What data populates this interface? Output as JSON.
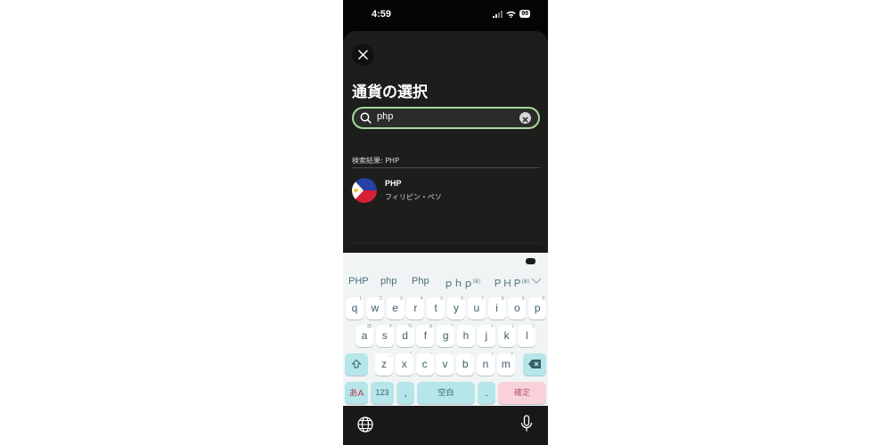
{
  "status_bar": {
    "time": "4:59",
    "battery": "99"
  },
  "sheet": {
    "title": "通貨の選択",
    "search": {
      "value": "php"
    },
    "results_label": "検索結果: PHP",
    "results": [
      {
        "code": "PHP",
        "name": "フィリピン・ペソ",
        "flag": "philippines-flag"
      }
    ]
  },
  "keyboard": {
    "candidates": [
      "PHP",
      "php",
      "Php",
      "ｐｈｐ",
      "ＰＨＰ"
    ],
    "candidate_marks": [
      "[全]",
      "[全]"
    ],
    "row1": [
      {
        "k": "q",
        "h": "1"
      },
      {
        "k": "w",
        "h": "2"
      },
      {
        "k": "e",
        "h": "3"
      },
      {
        "k": "r",
        "h": "4"
      },
      {
        "k": "t",
        "h": "5"
      },
      {
        "k": "y",
        "h": "6"
      },
      {
        "k": "u",
        "h": "7"
      },
      {
        "k": "i",
        "h": "8"
      },
      {
        "k": "o",
        "h": "9"
      },
      {
        "k": "p",
        "h": "0"
      }
    ],
    "row2": [
      {
        "k": "a",
        "h": "@"
      },
      {
        "k": "s",
        "h": "#"
      },
      {
        "k": "d",
        "h": "%"
      },
      {
        "k": "f",
        "h": "&"
      },
      {
        "k": "g",
        "h": "*"
      },
      {
        "k": "h",
        "h": "-"
      },
      {
        "k": "j",
        "h": "+"
      },
      {
        "k": "k",
        "h": "("
      },
      {
        "k": "l",
        "h": ")"
      }
    ],
    "row3": [
      {
        "k": "z",
        "h": "_"
      },
      {
        "k": "x",
        "h": "\""
      },
      {
        "k": "c",
        "h": "'"
      },
      {
        "k": "v",
        "h": ":"
      },
      {
        "k": "b",
        "h": ";"
      },
      {
        "k": "n",
        "h": "!"
      },
      {
        "k": "m",
        "h": "?"
      }
    ],
    "mode_key": "あA",
    "numbers_key": "123",
    "comma_key": ",",
    "space_key": "空白",
    "period_key": ".",
    "confirm_key": "確定",
    "colors": {
      "teal": "#b4e6ea",
      "pink": "#f8d2d8",
      "key_text": "#3b5f6a"
    }
  },
  "icons": [
    "close-icon",
    "search-icon",
    "clear-icon",
    "chevron-down-icon",
    "shift-icon",
    "backspace-icon",
    "globe-icon",
    "microphone-icon"
  ]
}
